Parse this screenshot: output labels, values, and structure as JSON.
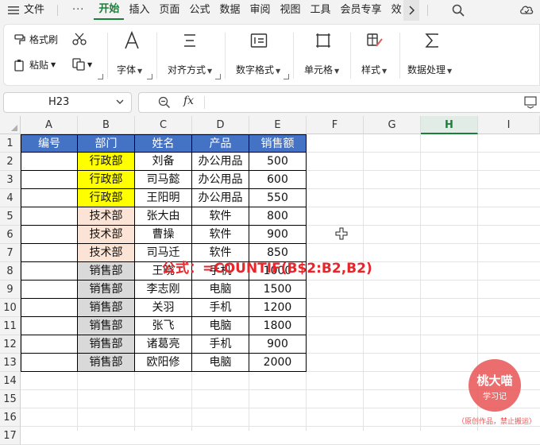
{
  "menubar": {
    "file": "文件",
    "more": "···",
    "tabs": [
      "开始",
      "插入",
      "页面",
      "公式",
      "数据",
      "审阅",
      "视图",
      "工具",
      "会员专享",
      "效"
    ],
    "active_tab": "开始"
  },
  "ribbon": {
    "format_painter": "格式刷",
    "paste": "粘贴",
    "groups": [
      "字体",
      "对齐方式",
      "数字格式",
      "单元格",
      "样式",
      "数据处理"
    ]
  },
  "formula_bar": {
    "cell_ref": "H23",
    "fx": "fx",
    "content": ""
  },
  "grid": {
    "columns": [
      "A",
      "B",
      "C",
      "D",
      "E",
      "F",
      "G",
      "H",
      "I"
    ],
    "selected_column": "H",
    "rows": [
      "1",
      "2",
      "3",
      "4",
      "5",
      "6",
      "7",
      "8",
      "9",
      "10",
      "11",
      "12",
      "13",
      "14",
      "15",
      "16",
      "17"
    ],
    "header": [
      "编号",
      "部门",
      "姓名",
      "产品",
      "销售额"
    ],
    "data": [
      {
        "dept": "行政部",
        "name": "刘备",
        "product": "办公用品",
        "sales": "500",
        "fill": "yellow"
      },
      {
        "dept": "行政部",
        "name": "司马懿",
        "product": "办公用品",
        "sales": "600",
        "fill": "yellow"
      },
      {
        "dept": "行政部",
        "name": "王阳明",
        "product": "办公用品",
        "sales": "550",
        "fill": "yellow"
      },
      {
        "dept": "技术部",
        "name": "张大由",
        "product": "软件",
        "sales": "800",
        "fill": "peach"
      },
      {
        "dept": "技术部",
        "name": "曹操",
        "product": "软件",
        "sales": "900",
        "fill": "peach"
      },
      {
        "dept": "技术部",
        "name": "司马迁",
        "product": "软件",
        "sales": "850",
        "fill": "peach"
      },
      {
        "dept": "销售部",
        "name": "王晓",
        "product": "手机",
        "sales": "1000",
        "fill": "grey"
      },
      {
        "dept": "销售部",
        "name": "李志刚",
        "product": "电脑",
        "sales": "1500",
        "fill": "grey"
      },
      {
        "dept": "销售部",
        "name": "关羽",
        "product": "手机",
        "sales": "1200",
        "fill": "grey"
      },
      {
        "dept": "销售部",
        "name": "张飞",
        "product": "电脑",
        "sales": "1800",
        "fill": "grey"
      },
      {
        "dept": "销售部",
        "name": "诸葛亮",
        "product": "手机",
        "sales": "900",
        "fill": "grey"
      },
      {
        "dept": "销售部",
        "name": "欧阳修",
        "product": "电脑",
        "sales": "2000",
        "fill": "grey"
      }
    ]
  },
  "annotation": {
    "formula_caption": "公式：=COUNTIF(B$2:B2,B2)"
  },
  "watermark": {
    "name": "桃大喵",
    "sub": "学习记",
    "note": "（原创作品，禁止搬运）"
  },
  "colors": {
    "accent": "#1a7f37",
    "header_fill": "#4472c4",
    "dept_admin": "#ffff00",
    "dept_tech": "#fbe4d5",
    "dept_sales": "#d9d9d9",
    "caption": "#e8252b"
  }
}
